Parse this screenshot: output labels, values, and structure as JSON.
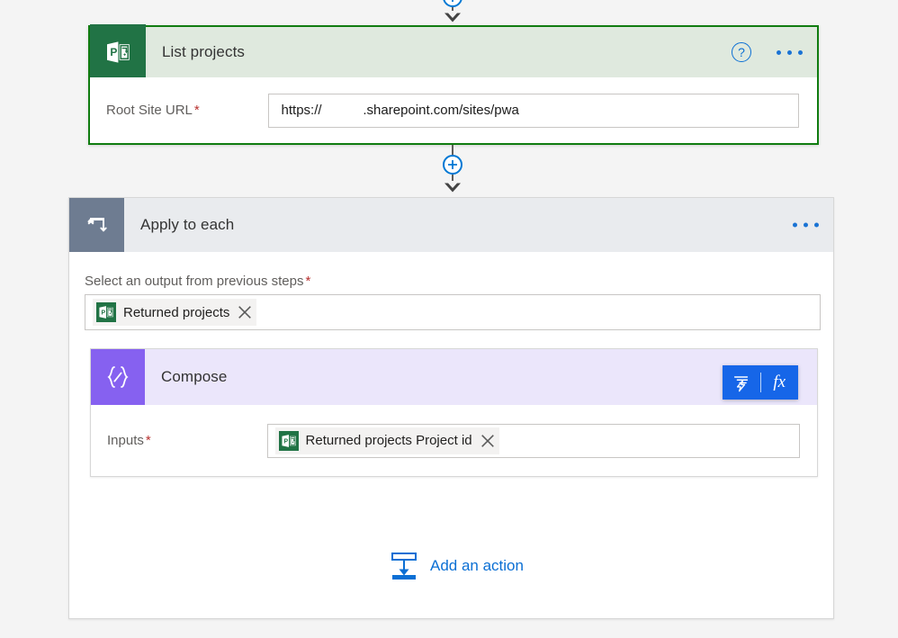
{
  "theme": {
    "page_bg": "#f4f4f4",
    "accent_blue": "#0b6fd4",
    "project_green": "#217345",
    "selected_border_green": "#107c10",
    "compose_purple": "#8661f0",
    "loop_slate": "#6e7c91",
    "required_red": "#b8312f",
    "fx_blue": "#1666e8"
  },
  "connectors": {
    "top": {
      "name": "insert-step-top",
      "plus_label": "+"
    },
    "middle": {
      "name": "insert-step-middle",
      "plus_label": "+"
    }
  },
  "list_projects_card": {
    "title": "List projects",
    "icon": "microsoft-project-icon",
    "help_label": "?",
    "menu_label": "...",
    "field": {
      "label": "Root Site URL",
      "required_marker": "*",
      "value_prefix": "https://",
      "value_suffix": ".sharepoint.com/sites/pwa",
      "redacted_gap": "           "
    }
  },
  "apply_to_each": {
    "title": "Apply to each",
    "icon": "loop-icon",
    "menu_label": "...",
    "output_field": {
      "label": "Select an output from previous steps",
      "required_marker": "*",
      "token": {
        "label": "Returned projects",
        "icon": "microsoft-project-icon",
        "remove_label": "x"
      }
    },
    "add_action": {
      "label": "Add an action",
      "icon": "add-action-icon"
    }
  },
  "compose_card": {
    "title": "Compose",
    "icon": "compose-braces-icon",
    "inputs_field": {
      "label": "Inputs",
      "required_marker": "*",
      "token": {
        "label": "Returned projects Project id",
        "icon": "microsoft-project-icon",
        "remove_label": "x"
      }
    },
    "flyout": {
      "dynamic_content_label": "dynamic-content",
      "expression_label": "fx"
    }
  }
}
